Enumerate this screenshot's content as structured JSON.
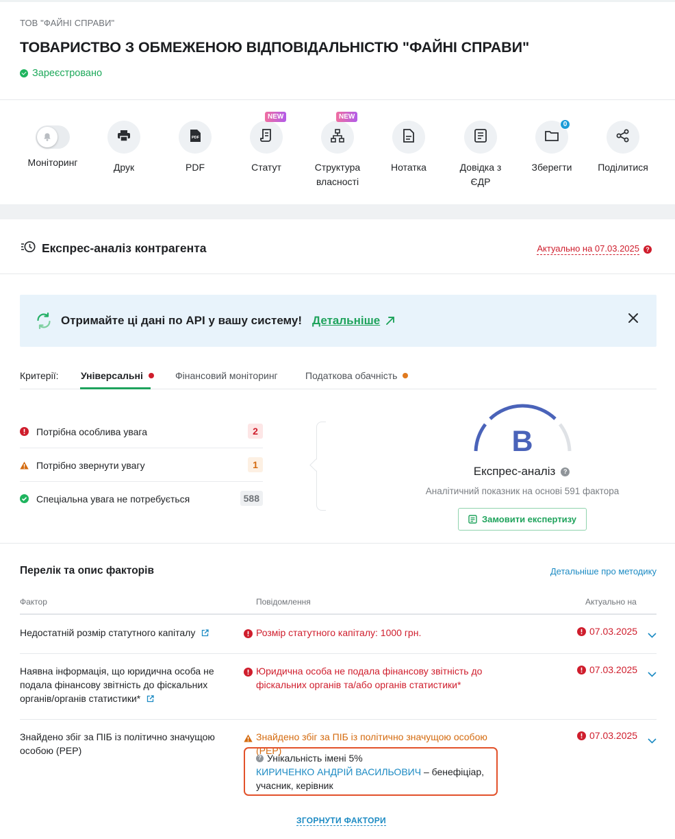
{
  "company": {
    "short_name": "ТОВ \"ФАЙНІ СПРАВИ\"",
    "full_name": "ТОВАРИСТВО З ОБМЕЖЕНОЮ ВІДПОВІДАЛЬНІСТЮ \"ФАЙНІ СПРАВИ\"",
    "status": "Зареєстровано",
    "status_color": "#1da85a"
  },
  "actions": [
    {
      "label": "Моніторинг",
      "icon": "bell-icon"
    },
    {
      "label": "Друк",
      "icon": "printer-icon"
    },
    {
      "label": "PDF",
      "icon": "pdf-icon"
    },
    {
      "label": "Статут",
      "icon": "scroll-icon",
      "badge": "NEW"
    },
    {
      "label": "Структура власності",
      "icon": "hierarchy-icon",
      "badge": "NEW"
    },
    {
      "label": "Нотатка",
      "icon": "note-icon"
    },
    {
      "label": "Довідка з ЄДР",
      "icon": "document-icon"
    },
    {
      "label": "Зберегти",
      "icon": "folder-icon",
      "count": "0"
    },
    {
      "label": "Поділитися",
      "icon": "share-icon"
    }
  ],
  "express": {
    "title": "Експрес-аналіз контрагента",
    "actual": "Актуально на 07.03.2025",
    "api_banner": {
      "text": "Отримайте ці дані по API у вашу систему!",
      "link": "Детальніше"
    },
    "tabs": {
      "criteria_label": "Критерії:",
      "items": [
        {
          "label": "Універсальні",
          "dot_color": "#cf1d2c",
          "active": true
        },
        {
          "label": "Фінансовий моніторинг"
        },
        {
          "label": "Податкова обачність",
          "dot_color": "#e07a1f"
        }
      ]
    },
    "criteria": [
      {
        "label": "Потрібна особлива увага",
        "count": "2",
        "level": "red"
      },
      {
        "label": "Потрібно звернути увагу",
        "count": "1",
        "level": "orange"
      },
      {
        "label": "Спеціальна увага не потребується",
        "count": "588",
        "level": "green"
      }
    ],
    "grade": "B",
    "name": "Експрес-аналіз",
    "subtitle": "Аналітичний показник на основі 591 фактора",
    "order_button": "Замовити експертизу"
  },
  "factors": {
    "title": "Перелік та опис факторів",
    "method_link": "Детальніше про методику",
    "headers": {
      "factor": "Фактор",
      "message": "Повідомлення",
      "date": "Актуально на"
    },
    "rows": [
      {
        "factor": "Недостатній розмір статутного капіталу",
        "message": "Розмір статутного капіталу: 1000 грн.",
        "level": "red",
        "date": "07.03.2025"
      },
      {
        "factor": "Наявна інформація, що юридична особа не подала фінансову звітність до фіскальних органів/органів статистики*",
        "message": "Юридична особа не подала фінансову звітність до фіскальних органів та/або органів статистики*",
        "level": "red",
        "date": "07.03.2025"
      },
      {
        "factor": "Знайдено збіг за ПІБ із політично значущою особою (PEP)",
        "message": "Знайдено збіг за ПІБ із політично значущою особою (PEP)",
        "level": "orange",
        "date": "07.03.2025",
        "pep": {
          "uniqueness": "Унікальність імені 5%",
          "person": "КИРИЧЕНКО АНДРІЙ ВАСИЛЬОВИЧ",
          "roles": " – бенефіціар, учасник, керівник"
        }
      }
    ],
    "collapse": "ЗГОРНУТИ ФАКТОРИ"
  },
  "colors": {
    "accent_green": "#1fa35c",
    "danger_red": "#cf1d2c",
    "warning_orange": "#d46a0e",
    "link_blue": "#1b8ac3",
    "grade_blue": "#4a63b9"
  }
}
